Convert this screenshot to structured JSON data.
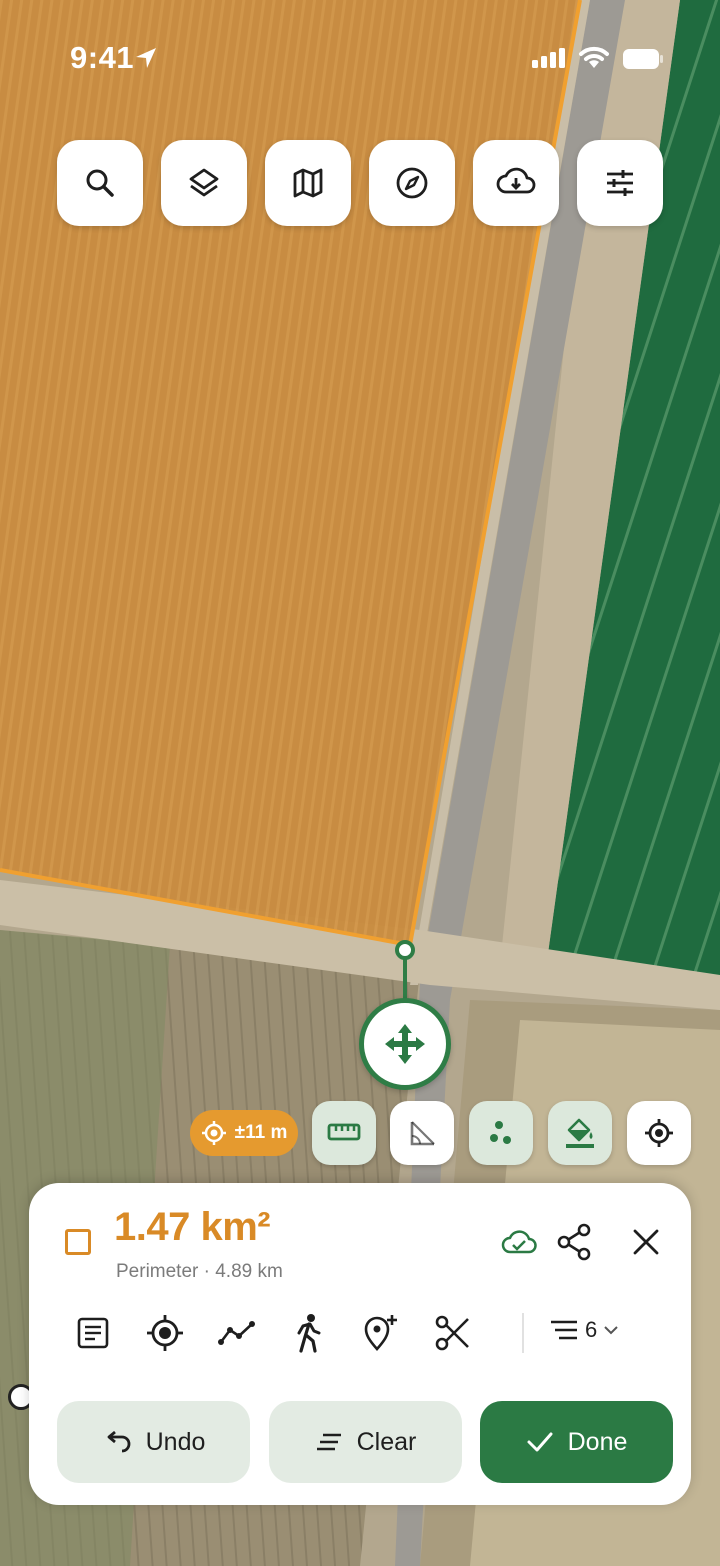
{
  "status_bar": {
    "time": "9:41"
  },
  "toolbar": {
    "icons": [
      "search-icon",
      "layers-icon",
      "map-icon",
      "compass-icon",
      "cloud-download-icon",
      "sliders-icon"
    ]
  },
  "map_tools": {
    "accuracy_label": "±11 m",
    "icons": [
      "ruler-icon",
      "angle-icon",
      "points-icon",
      "paint-bucket-icon",
      "my-location-icon"
    ]
  },
  "measurement": {
    "area": "1.47 km²",
    "perimeter": "Perimeter · 4.89 km",
    "layer_count": "6"
  },
  "sheet_tools": [
    "notes-icon",
    "target-icon",
    "polyline-icon",
    "walk-icon",
    "add-pin-icon",
    "scissors-icon"
  ],
  "actions": {
    "undo": "Undo",
    "clear": "Clear",
    "done": "Done"
  },
  "colors": {
    "accent_green": "#2b7a44",
    "field_orange": "#d98a26",
    "accuracy_orange": "#e59a2f"
  }
}
